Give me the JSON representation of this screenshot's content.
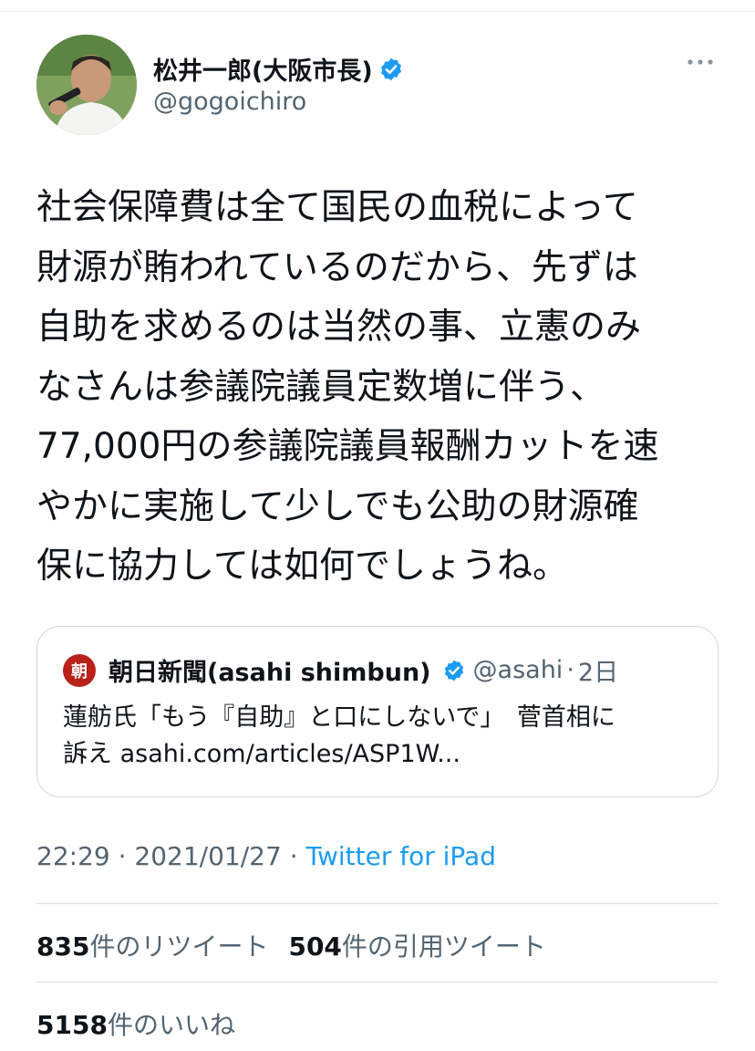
{
  "author": {
    "display_name": "松井一郎(大阪市長)",
    "handle": "@gogoichiro",
    "verified": true
  },
  "tweet": {
    "lines": [
      "社会保障費は全て国民の血税によって",
      "財源が賄われているのだから、先ずは",
      "自助を求めるのは当然の事、立憲のみ",
      "なさんは参議院議員定数増に伴う、",
      "77,000円の参議院議員報酬カットを速",
      "やかに実施して少しでも公助の財源確",
      "保に協力しては如何でしょうね。"
    ]
  },
  "quote": {
    "avatar_glyph": "朝",
    "display_name": "朝日新聞(asahi shimbun)",
    "handle": "@asahi",
    "separator": "·",
    "date": "2日",
    "body_lines": [
      "蓮舫氏「もう『自助』と口にしないで」　菅首相に",
      "訴え asahi.com/articles/ASP1W..."
    ]
  },
  "meta": {
    "time": "22:29",
    "sep1": " · ",
    "date": "2021/01/27",
    "sep2": " · ",
    "source": "Twitter for iPad"
  },
  "stats": {
    "retweets": {
      "count": "835",
      "label": "件のリツイート"
    },
    "quotes": {
      "count": "504",
      "label": "件の引用ツイート"
    },
    "likes": {
      "count": "5158",
      "label": "件のいいね"
    }
  },
  "colors": {
    "text": "#0f1419",
    "secondary": "#536471",
    "link": "#1d9bf0",
    "verified": "#1d9bf0",
    "asahi_red": "#b8221a"
  }
}
